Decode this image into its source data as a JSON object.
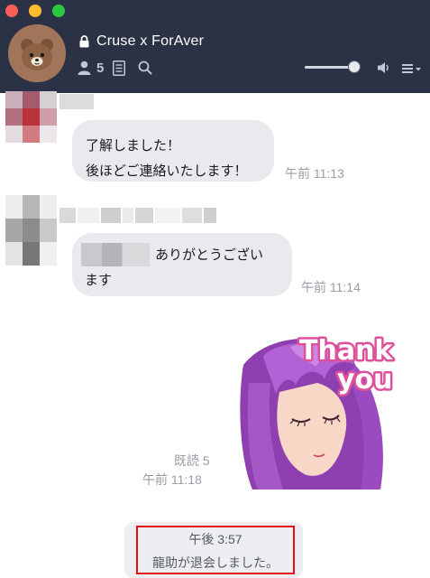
{
  "window": {
    "chat_title": "Cruse x ForAver",
    "member_count": "5",
    "volume_level": 0.88,
    "colors": {
      "header_bg": "#2b3245",
      "bubble_bg": "#e8eaed",
      "highlight": "#e5101a"
    },
    "icons": [
      "lock-icon",
      "member-icon",
      "notes-icon",
      "search-icon",
      "speaker-icon",
      "menu-icon"
    ]
  },
  "messages": [
    {
      "lines": [
        "了解しました！",
        "後ほどご連絡いたします！"
      ],
      "time": "午前 11:13"
    },
    {
      "lines": [
        "ありがとうござい",
        "ます"
      ],
      "time": "午前 11:14"
    }
  ],
  "sticker": {
    "read_label": "既読 5",
    "time": "午前 11:18",
    "text": [
      "Thank",
      "you"
    ]
  },
  "system": {
    "time": "午後 3:57",
    "text": "龍助が退会しました。"
  }
}
